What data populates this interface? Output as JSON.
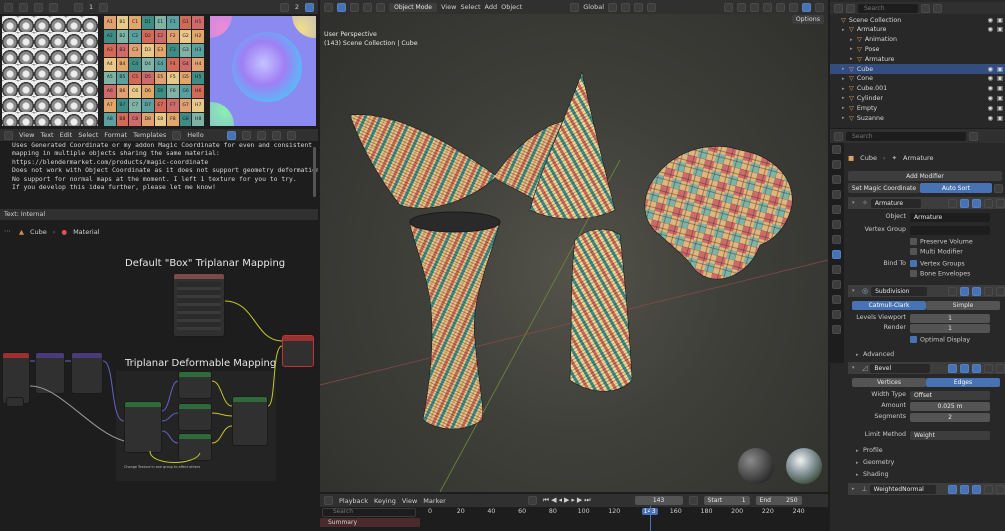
{
  "image_editor": {
    "slot_a": "1",
    "slot_b": "2",
    "letters": [
      "A",
      "B",
      "C",
      "D",
      "E",
      "F",
      "G",
      "H"
    ]
  },
  "text_editor": {
    "menu": [
      "View",
      "Text",
      "Edit",
      "Select",
      "Format",
      "Templates"
    ],
    "file_name": "Hello",
    "lines": [
      "Uses Generated Coordinate or my addon Magic Coordinate for even and consistent",
      "mapping in multiple objects sharing the same material:",
      "https://blendermarket.com/products/magic-coordinate",
      "Does not work with Object Coordinate as it does not support geometry deformations!",
      "No support for normal maps at the moment. I left 1 texture for you to try.",
      "If you develop this idea further, please let me know!"
    ],
    "footer": "Text: Internal"
  },
  "node_editor": {
    "breadcrumb_object": "Cube",
    "breadcrumb_material": "Material",
    "frame1_label": "Default \"Box\" Triplanar Mapping",
    "frame2_label": "Triplanar Deformable Mapping",
    "output_node": "Material Output",
    "box_node": "Image Texture",
    "frame_note": "Change Texture in one group to affect others"
  },
  "viewport": {
    "mode": "Object Mode",
    "menu": [
      "View",
      "Select",
      "Add",
      "Object"
    ],
    "orientation": "Global",
    "options": "Options",
    "overlay_line1": "User Perspective",
    "overlay_line2": "(143) Scene Collection | Cube"
  },
  "timeline": {
    "menu": [
      "Playback",
      "Keying",
      "View",
      "Marker"
    ],
    "frame_current": "143",
    "start_label": "Start",
    "start": "1",
    "end_label": "End",
    "end": "250",
    "ticks": [
      "0",
      "20",
      "40",
      "60",
      "80",
      "100",
      "120",
      "143",
      "160",
      "180",
      "200",
      "220",
      "240"
    ],
    "summary": "Summary",
    "search_placeholder": "Search"
  },
  "outliner": {
    "search_placeholder": "Search",
    "rows": [
      {
        "label": "Scene Collection",
        "indent": 0
      },
      {
        "label": "Armature",
        "indent": 1
      },
      {
        "label": "Animation",
        "indent": 2
      },
      {
        "label": "Pose",
        "indent": 2
      },
      {
        "label": "Armature",
        "indent": 2
      },
      {
        "label": "Cube",
        "indent": 1,
        "selected": true
      },
      {
        "label": "Cone",
        "indent": 1
      },
      {
        "label": "Cube.001",
        "indent": 1
      },
      {
        "label": "Cylinder",
        "indent": 1
      },
      {
        "label": "Empty",
        "indent": 1
      },
      {
        "label": "Suzanne",
        "indent": 1
      }
    ]
  },
  "properties": {
    "search_placeholder": "Search",
    "object": "Cube",
    "armature_ref": "Armature",
    "add_modifier": "Add Modifier",
    "set_magic": "Set Magic Coordinate",
    "auto_sort": "Auto Sort",
    "armature_mod": {
      "name": "Armature",
      "object_label": "Object",
      "object_value": "Armature",
      "vgroup_label": "Vertex Group",
      "preserve_volume": "Preserve Volume",
      "multi_modifier": "Multi Modifier",
      "bind_to": "Bind To",
      "vertex_groups": "Vertex Groups",
      "bone_envelopes": "Bone Envelopes"
    },
    "subdivision": {
      "name": "Subdivision",
      "catmull": "Catmull-Clark",
      "simple": "Simple",
      "levels_label": "Levels Viewport",
      "levels": "1",
      "render_label": "Render",
      "render": "1",
      "optimal": "Optimal Display",
      "advanced": "Advanced"
    },
    "bevel": {
      "name": "Bevel",
      "vertices": "Vertices",
      "edges": "Edges",
      "width_type_label": "Width Type",
      "width_type": "Offset",
      "amount_label": "Amount",
      "amount": "0.025 m",
      "segments_label": "Segments",
      "segments": "2",
      "limit_label": "Limit Method",
      "limit": "Weight",
      "profile": "Profile",
      "geometry": "Geometry",
      "shading": "Shading"
    },
    "weighted": "WeightedNormal"
  }
}
